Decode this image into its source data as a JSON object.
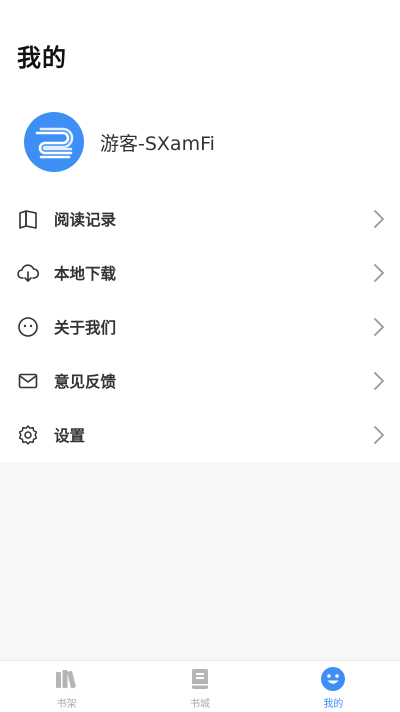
{
  "header": {
    "title": "我的"
  },
  "profile": {
    "username": "游客-SXamFi",
    "avatar_icon": "swirl-logo-icon",
    "accent": "#3d8ff5"
  },
  "menu": {
    "items": [
      {
        "label": "阅读记录",
        "icon": "book-icon"
      },
      {
        "label": "本地下载",
        "icon": "cloud-download-icon"
      },
      {
        "label": "关于我们",
        "icon": "smiley-icon"
      },
      {
        "label": "意见反馈",
        "icon": "mail-icon"
      },
      {
        "label": "设置",
        "icon": "gear-icon"
      }
    ]
  },
  "tabbar": {
    "tabs": [
      {
        "label": "书架",
        "icon": "bookshelf-icon",
        "active": false
      },
      {
        "label": "书城",
        "icon": "bookstore-icon",
        "active": false
      },
      {
        "label": "我的",
        "icon": "smiley-face-icon",
        "active": true
      }
    ],
    "active_color": "#3d8ff5",
    "inactive_color": "#a9a9a9"
  }
}
